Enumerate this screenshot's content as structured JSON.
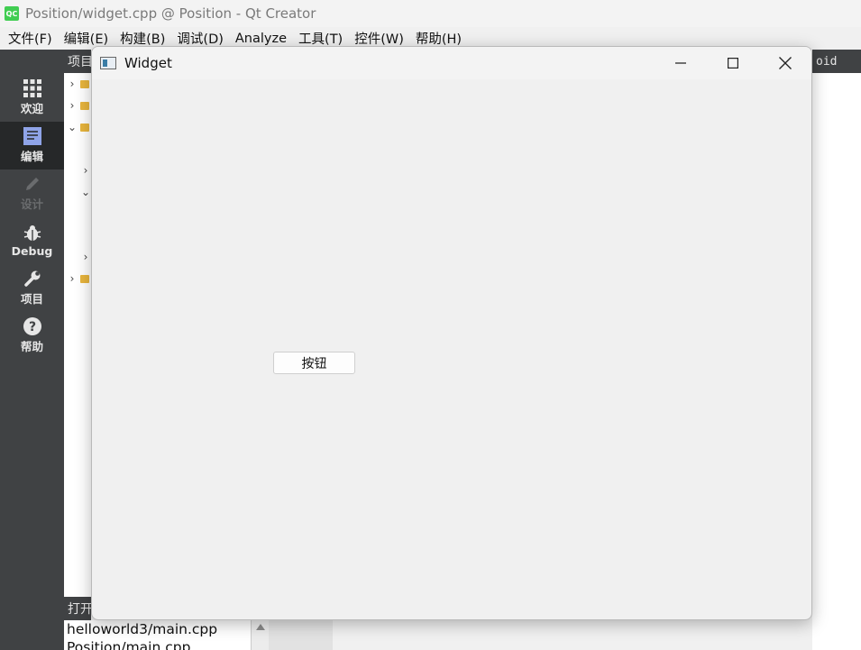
{
  "app": {
    "logo_text": "QC",
    "title": "Position/widget.cpp @ Position - Qt Creator"
  },
  "menu": [
    "文件(F)",
    "编辑(E)",
    "构建(B)",
    "调试(D)",
    "Analyze",
    "工具(T)",
    "控件(W)",
    "帮助(H)"
  ],
  "modes": [
    {
      "label": "欢迎",
      "icon": "grid-icon"
    },
    {
      "label": "编辑",
      "icon": "document-icon"
    },
    {
      "label": "设计",
      "icon": "pencil-icon"
    },
    {
      "label": "Debug",
      "icon": "bug-icon"
    },
    {
      "label": "项目",
      "icon": "wrench-icon"
    },
    {
      "label": "帮助",
      "icon": "help-icon"
    }
  ],
  "left_panel": {
    "header": "项目"
  },
  "open_files": {
    "header": "打开",
    "items": [
      "helloworld3/main.cpp",
      "Position/main.cpp"
    ]
  },
  "right_bar": {
    "text": "oid"
  },
  "widget": {
    "title": "Widget",
    "button_label": "按钮"
  },
  "colors": {
    "modebar": "#404244",
    "modebar_active": "#262829",
    "qt_green": "#41cd52"
  }
}
